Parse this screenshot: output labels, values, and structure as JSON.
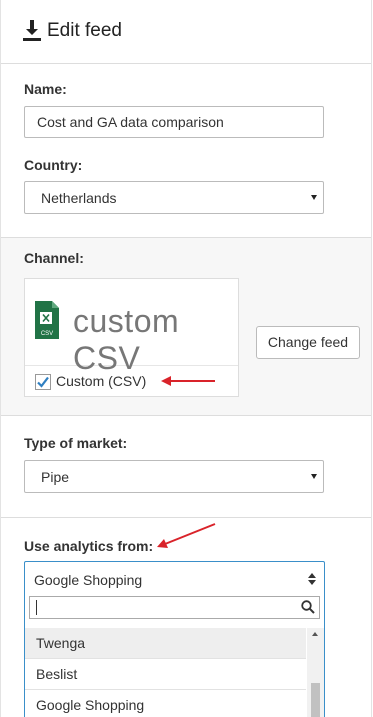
{
  "header": {
    "title": "Edit feed",
    "icon": "download-icon"
  },
  "name_field": {
    "label": "Name:",
    "value": "Cost and GA data comparison"
  },
  "country_field": {
    "label": "Country:",
    "selected": "Netherlands"
  },
  "channel": {
    "label": "Channel:",
    "logo_text": "custom CSV",
    "checkbox_label": "Custom (CSV)",
    "checked": true,
    "change_button": "Change feed"
  },
  "market_field": {
    "label": "Type of market:",
    "selected": "Pipe"
  },
  "analytics_field": {
    "label": "Use analytics from:",
    "selected": "Google Shopping",
    "search_value": "",
    "options": [
      "Twenga",
      "Beslist",
      "Google Shopping"
    ],
    "highlighted_index": 0
  },
  "colors": {
    "focus": "#3a8fc9",
    "annotation_arrow": "#d9232a",
    "excel_green": "#217346"
  }
}
